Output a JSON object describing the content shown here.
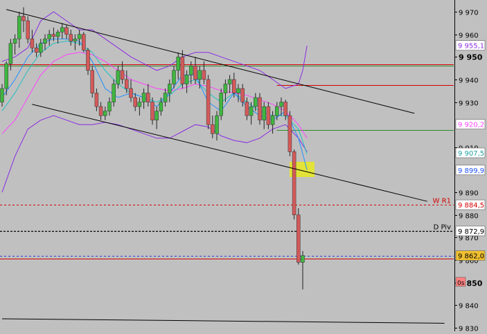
{
  "colors": {
    "background": "#c0c0c0",
    "up_candle": "#3fb63f",
    "down_candle": "#d45a5a",
    "wick": "#202020",
    "bollinger": "#8a2be2",
    "ema_fast": "#1e90ff",
    "ema_mid": "#20c0c0",
    "ema_slow": "#ff40ff",
    "trendline": "#000000",
    "resistance": "#d40000",
    "support_green": "#2e8b2e",
    "pivot": "#000000",
    "blue_dashed": "#2040d0",
    "highlight": "#e8e820"
  },
  "chart_data": {
    "type": "candlestick",
    "title": "",
    "xlabel": "",
    "ylabel": "",
    "ylim": [
      9829,
      9972
    ],
    "y_ticks": [
      {
        "value": 9970,
        "label": "9 970",
        "bold": false
      },
      {
        "value": 9960,
        "label": "9 960",
        "bold": false
      },
      {
        "value": 9950,
        "label": "9 950",
        "bold": true
      },
      {
        "value": 9940,
        "label": "9 940",
        "bold": false
      },
      {
        "value": 9930,
        "label": "9 930",
        "bold": false
      },
      {
        "value": 9910,
        "label": "9 910",
        "bold": false
      },
      {
        "value": 9890,
        "label": "9 890",
        "bold": false
      },
      {
        "value": 9880,
        "label": "9 880",
        "bold": false
      },
      {
        "value": 9870,
        "label": "9 870",
        "bold": false
      },
      {
        "value": 9860,
        "label": "9 860",
        "bold": false
      },
      {
        "value": 9850,
        "label": "9 850",
        "bold": true
      },
      {
        "value": 9840,
        "label": "9 840",
        "bold": false
      },
      {
        "value": 9830,
        "label": "9 830",
        "bold": false
      }
    ],
    "price_tags": [
      {
        "value": 9955.1,
        "label": "9 955,1",
        "fg": "#8a2be2",
        "bg": "#ffffff"
      },
      {
        "value": 9920.2,
        "label": "9 920,2",
        "fg": "#ff40ff",
        "bg": "#ffffff"
      },
      {
        "value": 9907.5,
        "label": "9 907,5",
        "fg": "#20a0a0",
        "bg": "#ffffff"
      },
      {
        "value": 9899.9,
        "label": "9 899,9",
        "fg": "#1e50ff",
        "bg": "#ffffff"
      },
      {
        "value": 9884.5,
        "label": "9 884,5",
        "fg": "#d40000",
        "bg": "#ffffff"
      },
      {
        "value": 9872.9,
        "label": "9 872,9",
        "fg": "#000000",
        "bg": "#ffffff"
      },
      {
        "value": 9862.0,
        "label": "9 862,0",
        "fg": "#000000",
        "bg": "#f0c030"
      }
    ],
    "timer_tag": {
      "value": 9854.5,
      "label": "0s",
      "fg": "#000000",
      "bg": "#ff8080"
    },
    "hlines": [
      {
        "value": 9946.8,
        "color": "#d40000",
        "style": "solid",
        "x_from": 0
      },
      {
        "value": 9946.2,
        "color": "#2e8b2e",
        "style": "solid",
        "x_from": 0
      },
      {
        "value": 9937.5,
        "color": "#d40000",
        "style": "solid",
        "x_from": 0.61
      },
      {
        "value": 9917.5,
        "color": "#2e8b2e",
        "style": "solid",
        "x_from": 0.61
      },
      {
        "value": 9884.5,
        "color": "#d40000",
        "style": "dashed",
        "x_from": 0,
        "text": "W R1"
      },
      {
        "value": 9872.9,
        "color": "#000000",
        "style": "dashed",
        "x_from": 0,
        "text": "D Piv"
      },
      {
        "value": 9862.0,
        "color": "#2040d0",
        "style": "dashed",
        "x_from": 0
      },
      {
        "value": 9860.5,
        "color": "#d40000",
        "style": "solid",
        "x_from": 0
      }
    ],
    "trendlines": [
      {
        "from": [
          1,
          9971
        ],
        "to": [
          96,
          9925
        ]
      },
      {
        "from": [
          7,
          9929
        ],
        "to": [
          99,
          9886
        ]
      },
      {
        "from": [
          0,
          9834
        ],
        "to": [
          103,
          9832
        ]
      }
    ],
    "candles": [
      [
        9930,
        9938,
        9928,
        9936
      ],
      [
        9936,
        9948,
        9933,
        9947
      ],
      [
        9947,
        9958,
        9944,
        9956
      ],
      [
        9956,
        9960,
        9951,
        9958
      ],
      [
        9958,
        9970,
        9954,
        9968
      ],
      [
        9968,
        9972,
        9961,
        9966
      ],
      [
        9966,
        9968,
        9956,
        9958
      ],
      [
        9958,
        9962,
        9952,
        9954
      ],
      [
        9954,
        9956,
        9950,
        9952
      ],
      [
        9952,
        9958,
        9950,
        9956
      ],
      [
        9956,
        9960,
        9953,
        9958
      ],
      [
        9958,
        9962,
        9955,
        9960
      ],
      [
        9960,
        9963,
        9957,
        9959
      ],
      [
        9959,
        9962,
        9956,
        9961
      ],
      [
        9961,
        9965,
        9958,
        9963
      ],
      [
        9963,
        9964,
        9958,
        9960
      ],
      [
        9960,
        9962,
        9955,
        9957
      ],
      [
        9957,
        9960,
        9953,
        9958
      ],
      [
        9958,
        9962,
        9955,
        9960
      ],
      [
        9960,
        9961,
        9952,
        9953
      ],
      [
        9953,
        9954,
        9942,
        9944
      ],
      [
        9944,
        9946,
        9932,
        9934
      ],
      [
        9934,
        9936,
        9926,
        9928
      ],
      [
        9928,
        9930,
        9922,
        9924
      ],
      [
        9924,
        9928,
        9922,
        9926
      ],
      [
        9926,
        9932,
        9924,
        9930
      ],
      [
        9930,
        9940,
        9928,
        9938
      ],
      [
        9938,
        9946,
        9936,
        9944
      ],
      [
        9944,
        9948,
        9938,
        9940
      ],
      [
        9940,
        9944,
        9934,
        9936
      ],
      [
        9936,
        9940,
        9930,
        9932
      ],
      [
        9932,
        9934,
        9926,
        9928
      ],
      [
        9928,
        9932,
        9924,
        9930
      ],
      [
        9930,
        9936,
        9927,
        9934
      ],
      [
        9934,
        9938,
        9928,
        9930
      ],
      [
        9930,
        9932,
        9920,
        9922
      ],
      [
        9922,
        9928,
        9918,
        9926
      ],
      [
        9926,
        9932,
        9924,
        9930
      ],
      [
        9930,
        9936,
        9928,
        9934
      ],
      [
        9934,
        9940,
        9930,
        9938
      ],
      [
        9938,
        9946,
        9936,
        9944
      ],
      [
        9944,
        9952,
        9940,
        9950
      ],
      [
        9950,
        9953,
        9936,
        9938
      ],
      [
        9938,
        9944,
        9934,
        9942
      ],
      [
        9942,
        9948,
        9938,
        9946
      ],
      [
        9946,
        9950,
        9938,
        9940
      ],
      [
        9940,
        9946,
        9936,
        9944
      ],
      [
        9944,
        9948,
        9938,
        9940
      ],
      [
        9940,
        9942,
        9918,
        9920
      ],
      [
        9920,
        9924,
        9914,
        9916
      ],
      [
        9916,
        9926,
        9913,
        9924
      ],
      [
        9924,
        9936,
        9922,
        9934
      ],
      [
        9934,
        9940,
        9930,
        9938
      ],
      [
        9938,
        9942,
        9934,
        9940
      ],
      [
        9940,
        9943,
        9932,
        9934
      ],
      [
        9934,
        9938,
        9930,
        9936
      ],
      [
        9936,
        9938,
        9928,
        9930
      ],
      [
        9930,
        9932,
        9922,
        9924
      ],
      [
        9924,
        9930,
        9920,
        9928
      ],
      [
        9928,
        9934,
        9926,
        9932
      ],
      [
        9932,
        9934,
        9920,
        9922
      ],
      [
        9922,
        9930,
        9918,
        9928
      ],
      [
        9928,
        9930,
        9918,
        9920
      ],
      [
        9920,
        9926,
        9916,
        9924
      ],
      [
        9924,
        9930,
        9922,
        9928
      ],
      [
        9928,
        9932,
        9924,
        9930
      ],
      [
        9930,
        9931,
        9922,
        9924
      ],
      [
        9924,
        9926,
        9906,
        9908
      ],
      [
        9908,
        9909,
        9878,
        9880
      ],
      [
        9880,
        9883,
        9858,
        9859
      ],
      [
        9859,
        9864,
        9847,
        9862
      ]
    ],
    "bollinger_upper": [
      [
        0,
        9948
      ],
      [
        3,
        9950
      ],
      [
        6,
        9954
      ],
      [
        9,
        9966
      ],
      [
        12,
        9970
      ],
      [
        15,
        9966
      ],
      [
        18,
        9962
      ],
      [
        21,
        9962
      ],
      [
        24,
        9958
      ],
      [
        27,
        9954
      ],
      [
        30,
        9950
      ],
      [
        33,
        9947
      ],
      [
        36,
        9944
      ],
      [
        39,
        9946
      ],
      [
        42,
        9950
      ],
      [
        45,
        9952
      ],
      [
        48,
        9952
      ],
      [
        51,
        9950
      ],
      [
        54,
        9948
      ],
      [
        57,
        9946
      ],
      [
        60,
        9944
      ],
      [
        63,
        9940
      ],
      [
        66,
        9936
      ],
      [
        69,
        9938
      ],
      [
        70,
        9944
      ],
      [
        71,
        9955
      ]
    ],
    "bollinger_lower": [
      [
        0,
        9890
      ],
      [
        3,
        9906
      ],
      [
        6,
        9918
      ],
      [
        9,
        9922
      ],
      [
        12,
        9924
      ],
      [
        15,
        9922
      ],
      [
        18,
        9920
      ],
      [
        21,
        9920
      ],
      [
        24,
        9921
      ],
      [
        27,
        9920
      ],
      [
        30,
        9918
      ],
      [
        33,
        9916
      ],
      [
        36,
        9914
      ],
      [
        39,
        9914
      ],
      [
        42,
        9917
      ],
      [
        45,
        9920
      ],
      [
        48,
        9919
      ],
      [
        51,
        9915
      ],
      [
        54,
        9913
      ],
      [
        57,
        9912
      ],
      [
        60,
        9914
      ],
      [
        63,
        9918
      ],
      [
        66,
        9920
      ],
      [
        69,
        9914
      ],
      [
        71,
        9908
      ]
    ],
    "ema_slow": [
      [
        0,
        9916
      ],
      [
        3,
        9922
      ],
      [
        6,
        9932
      ],
      [
        9,
        9942
      ],
      [
        12,
        9948
      ],
      [
        15,
        9951
      ],
      [
        18,
        9952
      ],
      [
        21,
        9951
      ],
      [
        24,
        9948
      ],
      [
        27,
        9944
      ],
      [
        30,
        9940
      ],
      [
        33,
        9938
      ],
      [
        36,
        9936
      ],
      [
        39,
        9935
      ],
      [
        42,
        9936
      ],
      [
        45,
        9938
      ],
      [
        48,
        9937
      ],
      [
        51,
        9935
      ],
      [
        54,
        9934
      ],
      [
        57,
        9933
      ],
      [
        60,
        9931
      ],
      [
        63,
        9929
      ],
      [
        66,
        9926
      ],
      [
        69,
        9920
      ],
      [
        71,
        9914
      ]
    ],
    "ema_mid": [
      [
        0,
        9926
      ],
      [
        3,
        9934
      ],
      [
        6,
        9944
      ],
      [
        9,
        9952
      ],
      [
        12,
        9956
      ],
      [
        15,
        9957
      ],
      [
        18,
        9956
      ],
      [
        21,
        9952
      ],
      [
        24,
        9944
      ],
      [
        27,
        9938
      ],
      [
        30,
        9934
      ],
      [
        33,
        9932
      ],
      [
        36,
        9930
      ],
      [
        39,
        9933
      ],
      [
        42,
        9938
      ],
      [
        45,
        9940
      ],
      [
        48,
        9934
      ],
      [
        51,
        9930
      ],
      [
        54,
        9934
      ],
      [
        57,
        9930
      ],
      [
        60,
        9926
      ],
      [
        63,
        9924
      ],
      [
        66,
        9924
      ],
      [
        69,
        9918
      ],
      [
        71,
        9907
      ]
    ],
    "ema_fast": [
      [
        0,
        9932
      ],
      [
        3,
        9940
      ],
      [
        6,
        9950
      ],
      [
        9,
        9956
      ],
      [
        12,
        9958
      ],
      [
        15,
        9958
      ],
      [
        18,
        9957
      ],
      [
        21,
        9948
      ],
      [
        24,
        9936
      ],
      [
        27,
        9932
      ],
      [
        30,
        9934
      ],
      [
        33,
        9932
      ],
      [
        36,
        9928
      ],
      [
        39,
        9934
      ],
      [
        42,
        9942
      ],
      [
        45,
        9942
      ],
      [
        48,
        9930
      ],
      [
        51,
        9926
      ],
      [
        54,
        9934
      ],
      [
        57,
        9928
      ],
      [
        60,
        9924
      ],
      [
        63,
        9922
      ],
      [
        66,
        9926
      ],
      [
        69,
        9914
      ],
      [
        71,
        9900
      ]
    ]
  }
}
